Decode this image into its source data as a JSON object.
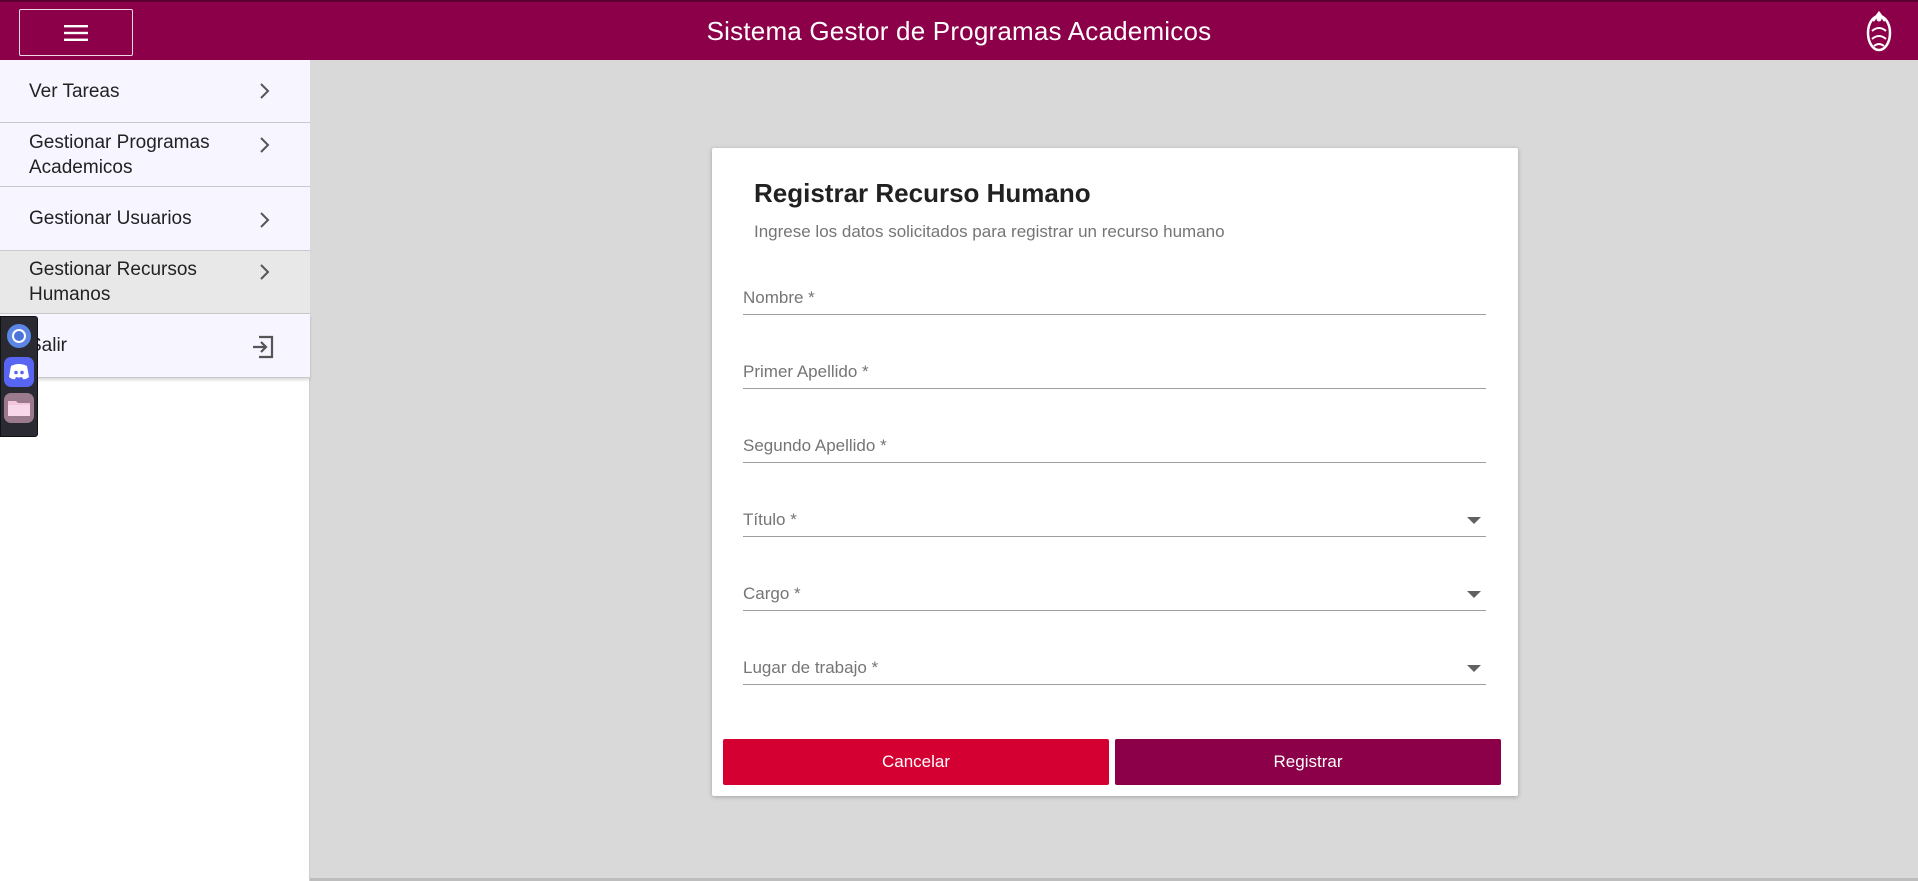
{
  "header": {
    "title": "Sistema Gestor de Programas Academicos",
    "menu_icon": "hamburger-menu-icon",
    "logo_icon": "institution-logo-icon"
  },
  "sidebar": {
    "items": [
      {
        "label": "Ver Tareas",
        "icon": "chevron-right-icon"
      },
      {
        "label": "Gestionar Programas Academicos",
        "icon": "chevron-right-icon"
      },
      {
        "label": "Gestionar Usuarios",
        "icon": "chevron-right-icon"
      },
      {
        "label": "Gestionar Recursos Humanos",
        "icon": "chevron-right-icon",
        "active": true
      },
      {
        "label": "Salir",
        "icon": "exit-icon"
      }
    ]
  },
  "dock": {
    "icons": [
      "chrome-icon",
      "discord-icon",
      "folder-icon"
    ]
  },
  "form": {
    "title": "Registrar Recurso Humano",
    "subtitle": "Ingrese los datos solicitados para registrar un recurso humano",
    "fields": [
      {
        "label": "Nombre *",
        "type": "text",
        "value": ""
      },
      {
        "label": "Primer Apellido *",
        "type": "text",
        "value": ""
      },
      {
        "label": "Segundo Apellido *",
        "type": "text",
        "value": ""
      },
      {
        "label": "Título *",
        "type": "select",
        "value": ""
      },
      {
        "label": "Cargo *",
        "type": "select",
        "value": ""
      },
      {
        "label": "Lugar de trabajo *",
        "type": "select",
        "value": ""
      }
    ],
    "cancel_label": "Cancelar",
    "submit_label": "Registrar"
  },
  "colors": {
    "brand": "#8b0048",
    "cancel": "#d50032",
    "background": "#d9d9d9"
  }
}
